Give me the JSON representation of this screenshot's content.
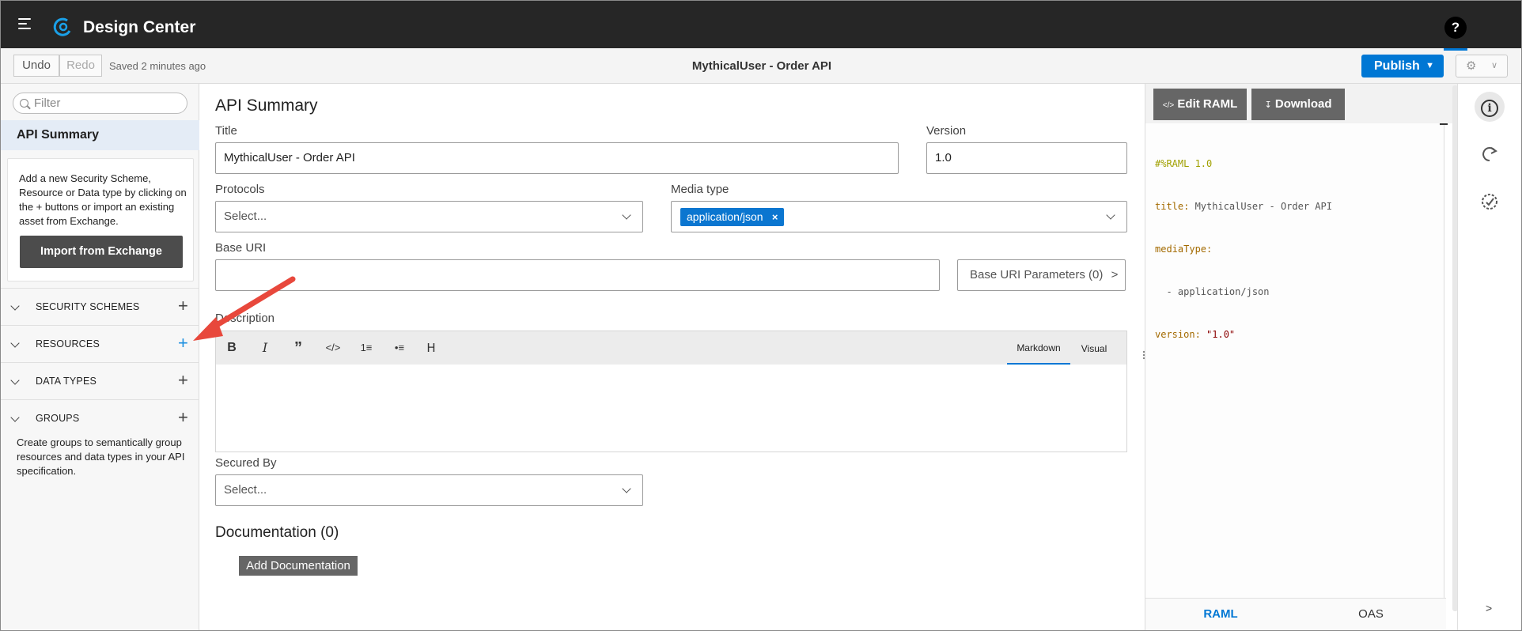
{
  "header": {
    "app_title": "Design Center",
    "help_label": "?"
  },
  "toolbar": {
    "undo_label": "Undo",
    "redo_label": "Redo",
    "saved_status": "Saved 2 minutes ago",
    "document_title": "MythicalUser - Order API",
    "publish_label": "Publish",
    "settings_icon": "gear-icon",
    "accent_color": "#0077d4"
  },
  "sidebar": {
    "filter_placeholder": "Filter",
    "selected_item": "API Summary",
    "info_text": "Add a new Security Scheme, Resource or Data type by clicking on the + buttons or import an existing asset from Exchange.",
    "import_button": "Import from Exchange",
    "sections": [
      {
        "label": "SECURITY SCHEMES",
        "add": "+"
      },
      {
        "label": "RESOURCES",
        "add": "+"
      },
      {
        "label": "DATA TYPES",
        "add": "+"
      },
      {
        "label": "GROUPS",
        "add": "+"
      }
    ],
    "groups_text": "Create groups to semantically group resources and data types in your API specification."
  },
  "main": {
    "heading": "API Summary",
    "title_label": "Title",
    "title_value": "MythicalUser - Order API",
    "version_label": "Version",
    "version_value": "1.0",
    "protocols_label": "Protocols",
    "protocols_placeholder": "Select...",
    "media_type_label": "Media type",
    "media_type_chip": "application/json",
    "chip_remove": "×",
    "base_uri_label": "Base URI",
    "base_uri_value": "",
    "base_uri_params": "Base URI Parameters (0)",
    "base_uri_params_chevron": ">",
    "description_label": "Description",
    "editor_buttons": [
      "B",
      "I",
      "”",
      "</>",
      "1≡",
      "•≡",
      "H"
    ],
    "markdown_tab": "Markdown",
    "visual_tab": "Visual",
    "secured_by_label": "Secured By",
    "secured_by_placeholder": "Select...",
    "documentation_heading": "Documentation (0)",
    "add_documentation": "Add Documentation"
  },
  "code_panel": {
    "edit_raml": "Edit RAML",
    "download": "Download",
    "lines": [
      {
        "k": "#%RAML 1.0",
        "v": ""
      },
      {
        "k": "title:",
        "v": " MythicalUser - Order API"
      },
      {
        "k": "mediaType:",
        "v": ""
      },
      {
        "k": "",
        "v": "  - application/json"
      },
      {
        "k": "version:",
        "v": " \"1.0\""
      }
    ],
    "tabs": [
      "RAML",
      "OAS"
    ]
  },
  "rail": {
    "icons": [
      "info-icon",
      "share-icon",
      "dial-icon"
    ],
    "expand": ">"
  }
}
